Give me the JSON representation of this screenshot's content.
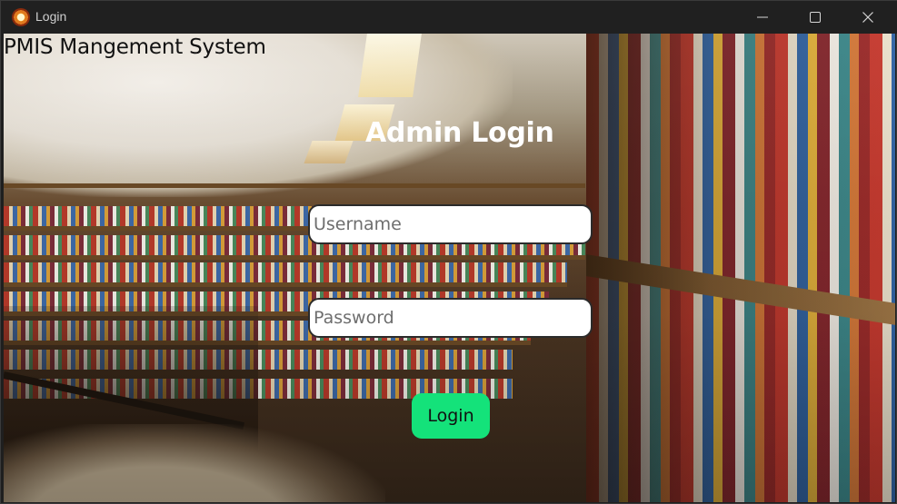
{
  "window": {
    "title": "Login",
    "controls": {
      "minimize": "minimize-icon",
      "maximize": "maximize-icon",
      "close": "close-icon"
    }
  },
  "app": {
    "name": "PMIS Mangement System",
    "heading": "Admin Login"
  },
  "form": {
    "username": {
      "value": "",
      "placeholder": "Username"
    },
    "password": {
      "value": "",
      "placeholder": "Password"
    },
    "submit_label": "Login"
  },
  "colors": {
    "login_button": "#14e27a",
    "heading_text": "#ffffff",
    "titlebar": "#202020"
  },
  "icons": {
    "app_icon": "app-logo-icon"
  },
  "background_image": "library-bookshelves"
}
